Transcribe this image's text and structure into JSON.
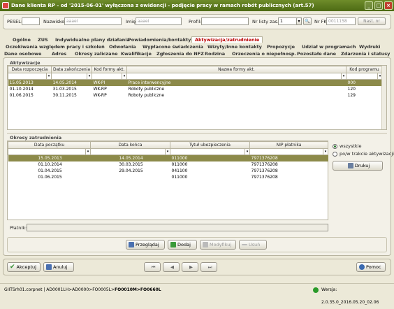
{
  "window": {
    "title": "Dane klienta RP - od '2015-06-01' wyłączona z ewidencji - podjęcie pracy w ramach robót publicznych (art.57)"
  },
  "search": {
    "pesel_label": "PESEL:",
    "nazwisko_label": "Nazwisko:",
    "nazwisko_value": "aaaei",
    "imie_label": "Imię:",
    "imie_value": "aaaei",
    "profil_label": "Profil:",
    "nr_listy_label": "Nr listy zas.:",
    "nr_listy_value": "1",
    "nr_fk_label": "Nr FK:",
    "nr_fk_value": "0011158",
    "nast_label": "Nast. nr"
  },
  "tabs_row1": [
    "Ogólne",
    "ZUS",
    "Indywidualne plany działania",
    "Powiadomienia/kontakty",
    "Aktywizacja/zatrudnienie"
  ],
  "tabs_row2": [
    "Oczekiwania względem pracy i szkoleń",
    "Odwołania",
    "Wypłacone świadczenia",
    "Wizyty/Inne kontakty",
    "Propozycje",
    "Udział w programach",
    "Wydruki"
  ],
  "tabs_row3": [
    "Dane osobowe",
    "Adres",
    "Okresy zaliczane",
    "Kwalifikacje",
    "Zgłoszenia do NFZ",
    "Rodzina",
    "Orzeczenia o niepełnosp.",
    "Pozostałe dane",
    "Zdarzenia i statusy"
  ],
  "aktywizacje": {
    "title": "Aktywizacje",
    "columns": [
      "Data rozpoczęcia",
      "Data zakończenia",
      "Kod formy akt.",
      "Nazwa formy akt.",
      "Kod programu"
    ],
    "rows": [
      [
        "15.05.2013",
        "14.05.2014",
        "WK-PI",
        "Prace interwencyjne",
        "000"
      ],
      [
        "01.10.2014",
        "31.03.2015",
        "WK-RP",
        "Roboty publiczne",
        "120"
      ],
      [
        "01.06.2015",
        "30.11.2015",
        "WK-RP",
        "Roboty publiczne",
        "129"
      ]
    ]
  },
  "okresy": {
    "title": "Okresy zatrudnienia",
    "columns": [
      "Data początku",
      "Data końca",
      "Tytuł ubezpieczenia",
      "NIP płatnika"
    ],
    "rows": [
      [
        "15.05.2013",
        "14.05.2014",
        "011000",
        "7971376208"
      ],
      [
        "01.10.2014",
        "30.03.2015",
        "011000",
        "7971376208"
      ],
      [
        "01.04.2015",
        "29.04.2015",
        "041100",
        "7971376208"
      ],
      [
        "01.06.2015",
        "",
        "011000",
        "7971376208"
      ]
    ],
    "radio_all": "wszystkie",
    "radio_during": "po/w trakcie aktywizacji",
    "print_label": "Drukuj",
    "platnik_label": "Płatnik:"
  },
  "actions": {
    "browse": "Przeglądaj",
    "add": "Dodaj",
    "modify": "Modyfikuj",
    "delete": "Usuń"
  },
  "footer": {
    "accept": "Akceptuj",
    "cancel": "Anuluj",
    "help": "Pomoc"
  },
  "status": {
    "path_plain": "GIITSrh01.corpnet | AD0001LH>AD0000>FO0005L>",
    "path_bold": "FO0010M>FO0660L",
    "version": "Wersja: 2.0.35.0_2016.05.20_02.06"
  },
  "colors": {
    "titlebar": "#5a7a1e",
    "selected_row": "#8c8a4a",
    "active_tab": "#bb0000"
  }
}
